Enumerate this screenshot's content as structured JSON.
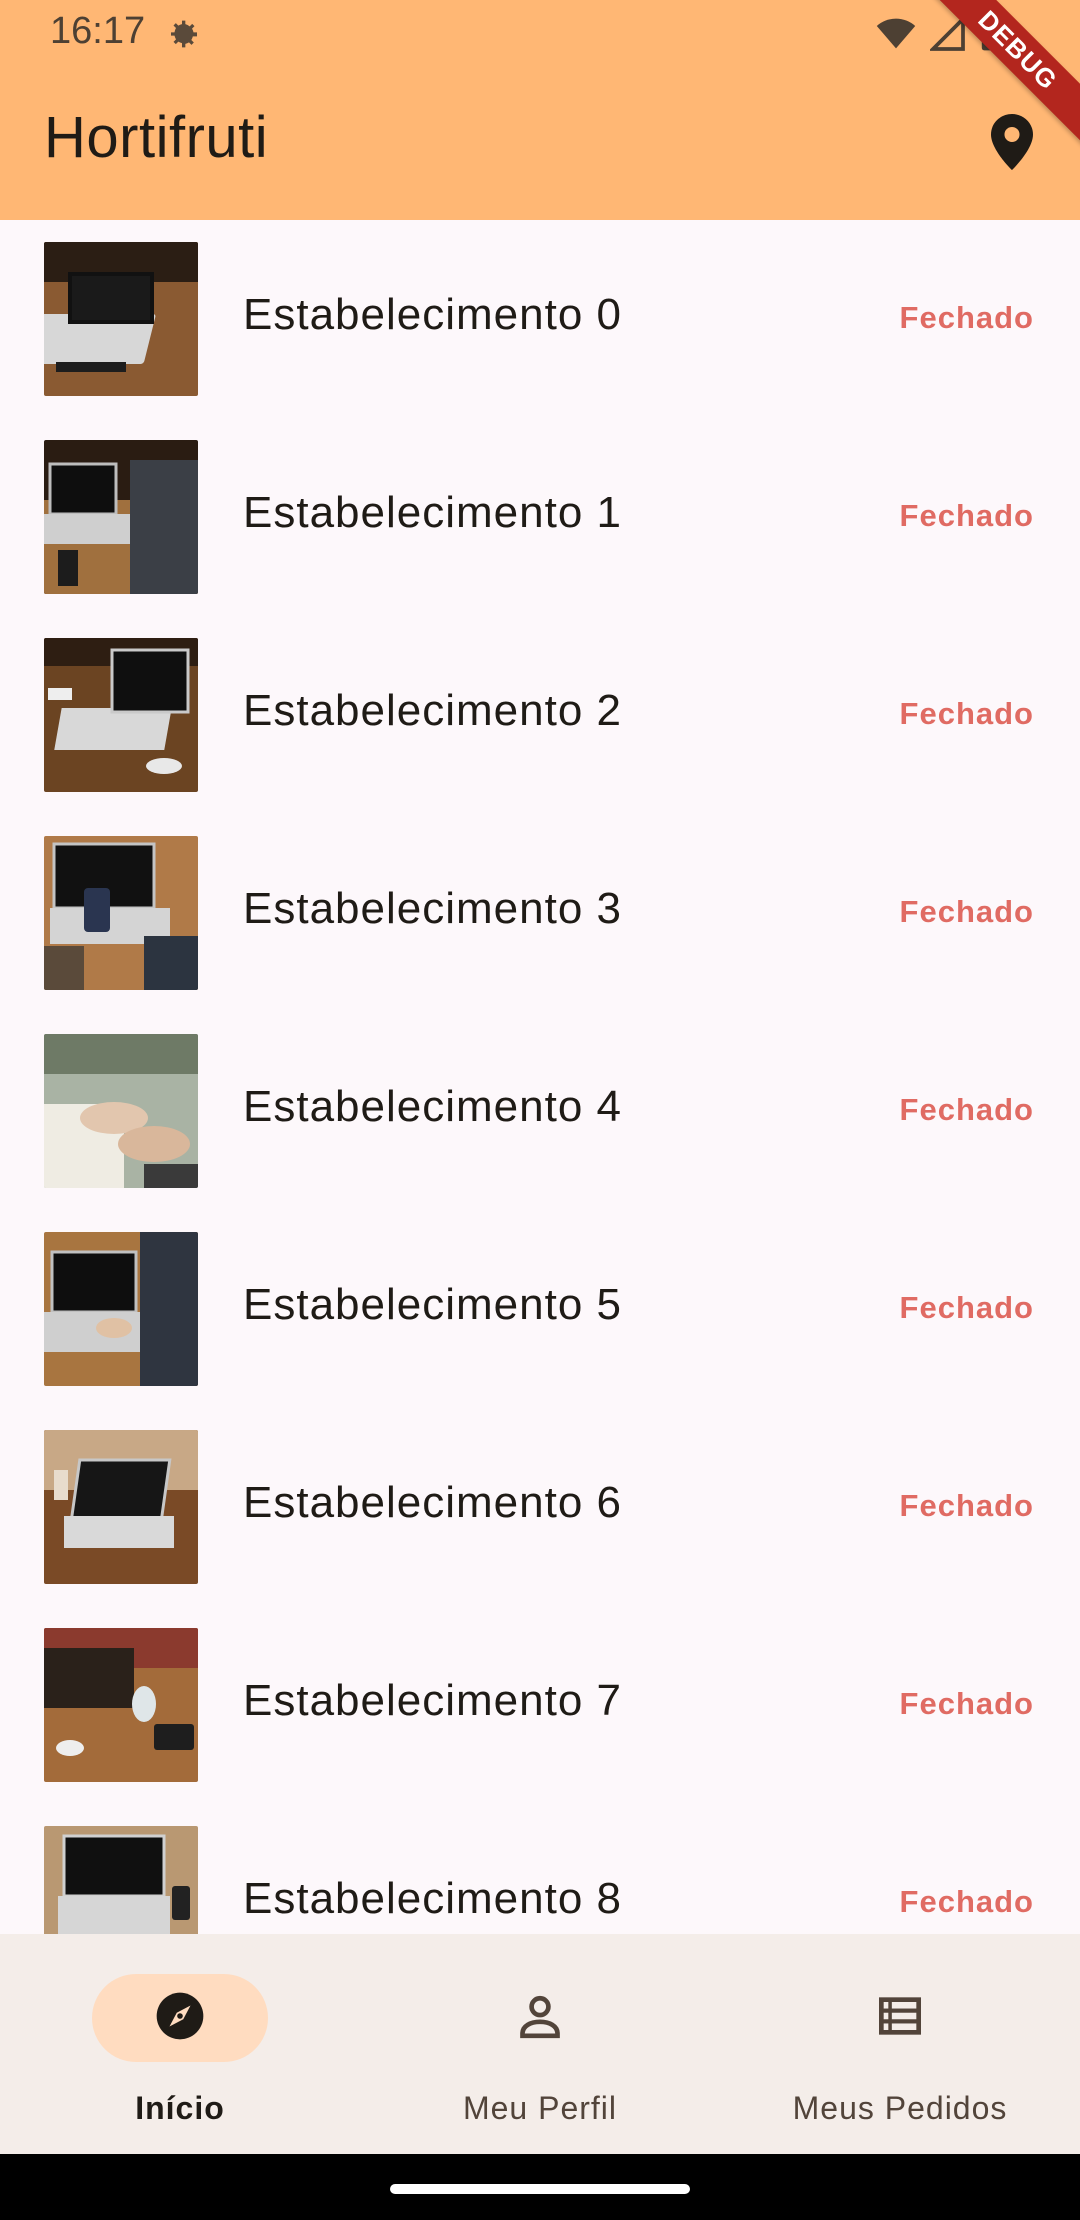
{
  "status_bar": {
    "time": "16:17"
  },
  "app_bar": {
    "title": "Hortifruti",
    "debug_label": "DEBUG",
    "background": "#ffb774"
  },
  "establishments": [
    {
      "name": "Estabelecimento 0",
      "status": "Fechado"
    },
    {
      "name": "Estabelecimento 1",
      "status": "Fechado"
    },
    {
      "name": "Estabelecimento 2",
      "status": "Fechado"
    },
    {
      "name": "Estabelecimento 3",
      "status": "Fechado"
    },
    {
      "name": "Estabelecimento 4",
      "status": "Fechado"
    },
    {
      "name": "Estabelecimento 5",
      "status": "Fechado"
    },
    {
      "name": "Estabelecimento 6",
      "status": "Fechado"
    },
    {
      "name": "Estabelecimento 7",
      "status": "Fechado"
    },
    {
      "name": "Estabelecimento 8",
      "status": "Fechado"
    }
  ],
  "bottom_nav": {
    "items": [
      {
        "label": "Início",
        "icon": "explore-icon",
        "active": true
      },
      {
        "label": "Meu Perfil",
        "icon": "person-icon",
        "active": false
      },
      {
        "label": "Meus Pedidos",
        "icon": "list-icon",
        "active": false
      }
    ]
  },
  "colors": {
    "status_closed": "#e06b63",
    "nav_active_pill": "#ffdcc0"
  }
}
